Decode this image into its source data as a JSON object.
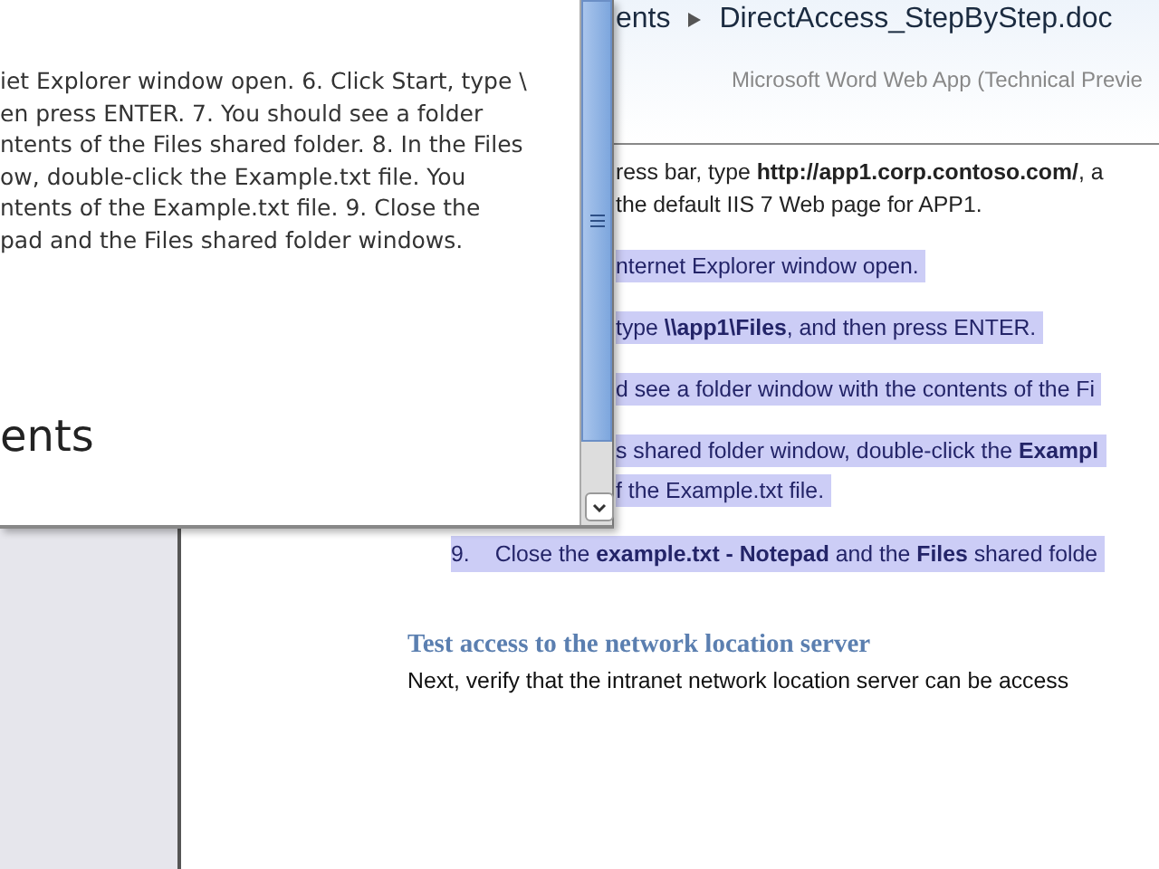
{
  "document_window": {
    "breadcrumb": [
      "ents",
      "DirectAccess_StepByStep.doc"
    ],
    "app_title": "Microsoft Word Web App (Technical Previe",
    "lines": [
      {
        "text": "ress bar, type **http://app1.corp.contoso.com/**, a",
        "highlighted": false
      },
      {
        "text": "the default IIS 7 Web page for APP1.",
        "highlighted": false
      },
      {
        "text": "nternet Explorer window open.",
        "highlighted": true
      },
      {
        "text": "type **\\\\app1\\Files**, and then press ENTER.",
        "highlighted": true
      },
      {
        "text": "d see a folder window with the contents of the Fi",
        "highlighted": true
      },
      {
        "text": "s shared folder window, double-click the **Exampl**",
        "highlighted": true
      },
      {
        "text": "f the Example.txt file.",
        "highlighted": true
      }
    ],
    "list_item": {
      "number": "9.",
      "text": "Close the **example.txt - Notepad** and the **Files** shared folde",
      "highlighted": true
    },
    "heading": "Test access to the network location server",
    "paragraph": "Next, verify that the intranet network location server can be access"
  },
  "notepad_window": {
    "lines": [
      "iet Explorer window open. 6. Click Start, type \\",
      "en press ENTER. 7. You should see a folder",
      "ntents of the Files shared folder. 8. In the Files",
      "ow, double-click the Example.txt file. You",
      "ntents of the Example.txt file. 9. Close the",
      "pad and the Files shared folder windows."
    ],
    "heading": "ents"
  }
}
